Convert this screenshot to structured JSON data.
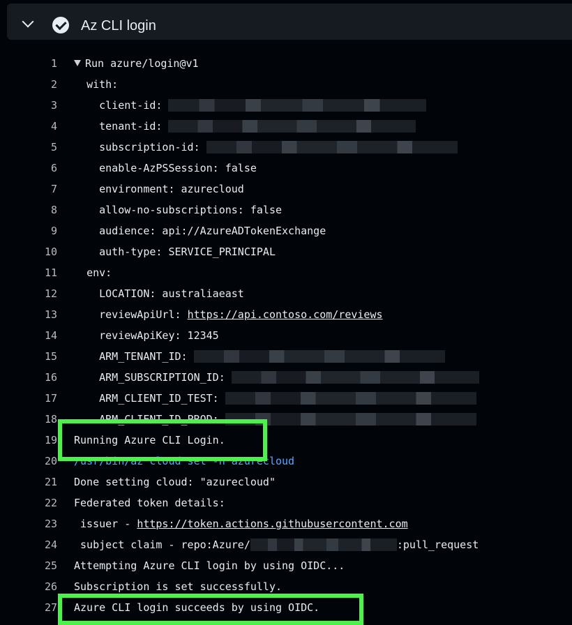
{
  "step": {
    "title": "Az CLI login",
    "status_icon": "check-circle-icon",
    "expand_icon": "chevron-down-icon"
  },
  "log_lines": [
    {
      "n": "1",
      "indent": "",
      "text": "Run azure/login@v1",
      "collapsible": true
    },
    {
      "n": "2",
      "indent": "  ",
      "text": "with:"
    },
    {
      "n": "3",
      "indent": "    ",
      "text": "client-id: ",
      "redacted": true,
      "rw": 370
    },
    {
      "n": "4",
      "indent": "    ",
      "text": "tenant-id: ",
      "redacted": true,
      "rw": 355
    },
    {
      "n": "5",
      "indent": "    ",
      "text": "subscription-id: ",
      "redacted": true,
      "rw": 360
    },
    {
      "n": "6",
      "indent": "    ",
      "text": "enable-AzPSSession: false"
    },
    {
      "n": "7",
      "indent": "    ",
      "text": "environment: azurecloud"
    },
    {
      "n": "8",
      "indent": "    ",
      "text": "allow-no-subscriptions: false"
    },
    {
      "n": "9",
      "indent": "    ",
      "text": "audience: api://AzureADTokenExchange"
    },
    {
      "n": "10",
      "indent": "    ",
      "text": "auth-type: SERVICE_PRINCIPAL"
    },
    {
      "n": "11",
      "indent": "  ",
      "text": "env:"
    },
    {
      "n": "12",
      "indent": "    ",
      "text": "LOCATION: australiaeast"
    },
    {
      "n": "13",
      "indent": "    ",
      "text": "reviewApiUrl: ",
      "link": "https://api.contoso.com/reviews"
    },
    {
      "n": "14",
      "indent": "    ",
      "text": "reviewApiKey: 12345"
    },
    {
      "n": "15",
      "indent": "    ",
      "text": "ARM_TENANT_ID: ",
      "redacted": true,
      "rw": 360
    },
    {
      "n": "16",
      "indent": "    ",
      "text": "ARM_SUBSCRIPTION_ID: ",
      "redacted": true,
      "rw": 355
    },
    {
      "n": "17",
      "indent": "    ",
      "text": "ARM_CLIENT_ID_TEST: ",
      "redacted": true,
      "rw": 360
    },
    {
      "n": "18",
      "indent": "    ",
      "text": "ARM_CLIENT_ID_PROD: ",
      "redacted": true,
      "rw": 360
    },
    {
      "n": "19",
      "indent": "",
      "text": "Running Azure CLI Login."
    },
    {
      "n": "20",
      "indent": "",
      "text": "",
      "cmd": "/usr/bin/az cloud set -n azurecloud"
    },
    {
      "n": "21",
      "indent": "",
      "text": "Done setting cloud: \"azurecloud\""
    },
    {
      "n": "22",
      "indent": "",
      "text": "Federated token details:"
    },
    {
      "n": "23",
      "indent": " ",
      "text": "issuer - ",
      "link": "https://token.actions.githubusercontent.com"
    },
    {
      "n": "24",
      "indent": " ",
      "text": "subject claim - repo:Azure/",
      "redacted": true,
      "rw": 210,
      "suffix": ":pull_request"
    },
    {
      "n": "25",
      "indent": "",
      "text": "Attempting Azure CLI login by using OIDC..."
    },
    {
      "n": "26",
      "indent": "",
      "text": "Subscription is set successfully."
    },
    {
      "n": "27",
      "indent": "",
      "text": "Azure CLI login succeeds by using OIDC."
    }
  ]
}
